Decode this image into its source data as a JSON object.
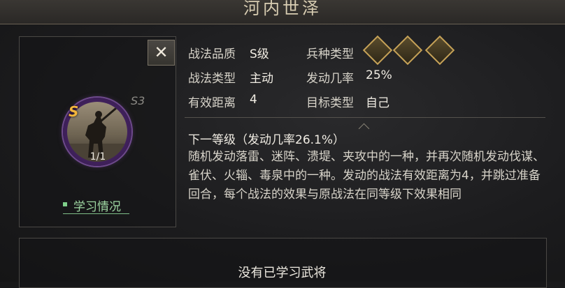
{
  "title": "河内世泽",
  "skill": {
    "level": "S3",
    "grade_badge": "S",
    "count": "1/1",
    "learn_label": "学习情况"
  },
  "attributes": {
    "quality_label": "战法品质",
    "quality_value": "S级",
    "type_label": "战法类型",
    "type_value": "主动",
    "range_label": "有效距离",
    "range_value": "4",
    "troop_label": "兵种类型",
    "rate_label": "发动几率",
    "rate_value": "25%",
    "target_label": "目标类型",
    "target_value": "自己"
  },
  "troop_icons": [
    "bow-troop-icon",
    "shield-troop-icon",
    "cavalry-troop-icon"
  ],
  "next_level": "下一等级（发动几率26.1%）",
  "description": "随机发动落雷、迷阵、溃堤、夹攻中的一种，并再次随机发动伐谋、雀伏、火辎、毒泉中的一种。发动的战法有效距离为4，并跳过准备回合，每个战法的效果与原战法在同等级下效果相同",
  "empty_message": "没有已学习武将",
  "colors": {
    "accent_green": "#9ed6a2",
    "grade_gold": "#f2b53c",
    "ring_purple": "#5a2f7a",
    "icon_gold": "#c6a257"
  }
}
